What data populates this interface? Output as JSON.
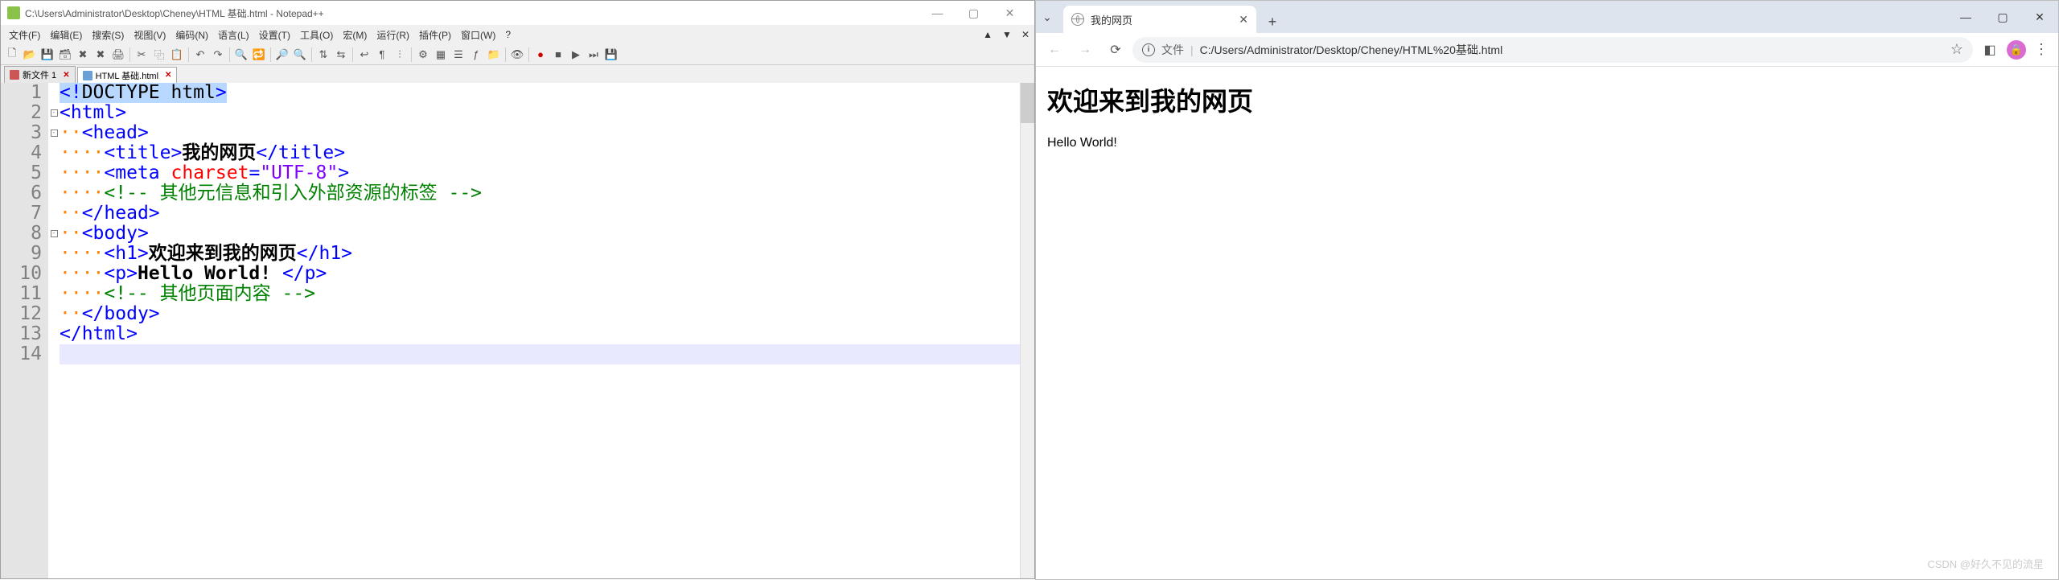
{
  "npp": {
    "title": "C:\\Users\\Administrator\\Desktop\\Cheney\\HTML 基础.html - Notepad++",
    "menus": [
      "文件(F)",
      "编辑(E)",
      "搜索(S)",
      "视图(V)",
      "编码(N)",
      "语言(L)",
      "设置(T)",
      "工具(O)",
      "宏(M)",
      "运行(R)",
      "插件(P)",
      "窗口(W)",
      "?"
    ],
    "tabs": [
      {
        "label": "新文件 1",
        "active": false,
        "dirty": true
      },
      {
        "label": "HTML 基础.html",
        "active": true,
        "dirty": false
      }
    ],
    "code": {
      "lines": [
        {
          "n": 1,
          "html": "<span class='hl'><span class='t-tag'>&lt;!</span><span class='t-doctype-kwd'>DOCTYPE html</span><span class='t-tag'>&gt;</span></span>"
        },
        {
          "n": 2,
          "fold": "⊟",
          "html": "<span class='t-tag'>&lt;html&gt;</span>"
        },
        {
          "n": 3,
          "fold": "⊟",
          "html": "<span class='t-whitespace'>··</span><span class='t-tag'>&lt;head&gt;</span>"
        },
        {
          "n": 4,
          "html": "<span class='t-whitespace'>····</span><span class='t-tag'>&lt;title&gt;</span><span class='t-text'>我的网页</span><span class='t-tag'>&lt;/title&gt;</span>"
        },
        {
          "n": 5,
          "html": "<span class='t-whitespace'>····</span><span class='t-tag'>&lt;meta</span> <span class='t-attr'>charset</span><span class='t-tag'>=</span><span class='t-str'>\"UTF-8\"</span><span class='t-tag'>&gt;</span>"
        },
        {
          "n": 6,
          "html": "<span class='t-whitespace'>····</span><span class='t-comment'>&lt;!-- 其他元信息和引入外部资源的标签 --&gt;</span>"
        },
        {
          "n": 7,
          "html": "<span class='t-whitespace'>··</span><span class='t-tag'>&lt;/head&gt;</span>"
        },
        {
          "n": 8,
          "fold": "⊟",
          "html": "<span class='t-whitespace'>··</span><span class='t-tag'>&lt;body&gt;</span>"
        },
        {
          "n": 9,
          "html": "<span class='t-whitespace'>····</span><span class='t-tag'>&lt;h1&gt;</span><span class='t-text'>欢迎来到我的网页</span><span class='t-tag'>&lt;/h1&gt;</span>"
        },
        {
          "n": 10,
          "html": "<span class='t-whitespace'>····</span><span class='t-tag'>&lt;p&gt;</span><span class='t-text'>Hello World! </span><span class='t-tag'>&lt;/p&gt;</span>"
        },
        {
          "n": 11,
          "html": "<span class='t-whitespace'>····</span><span class='t-comment'>&lt;!-- 其他页面内容 --&gt;</span>"
        },
        {
          "n": 12,
          "html": "<span class='t-whitespace'>··</span><span class='t-tag'>&lt;/body&gt;</span>"
        },
        {
          "n": 13,
          "html": "<span class='t-tag'>&lt;/html&gt;</span>"
        },
        {
          "n": 14,
          "current": true,
          "html": ""
        }
      ]
    }
  },
  "chrome": {
    "tab_title": "我的网页",
    "omnibox_label": "文件",
    "omnibox_url": "C:/Users/Administrator/Desktop/Cheney/HTML%20基础.html",
    "page_heading": "欢迎来到我的网页",
    "page_text": "Hello World!",
    "watermark": "CSDN @好久不见的流星"
  }
}
